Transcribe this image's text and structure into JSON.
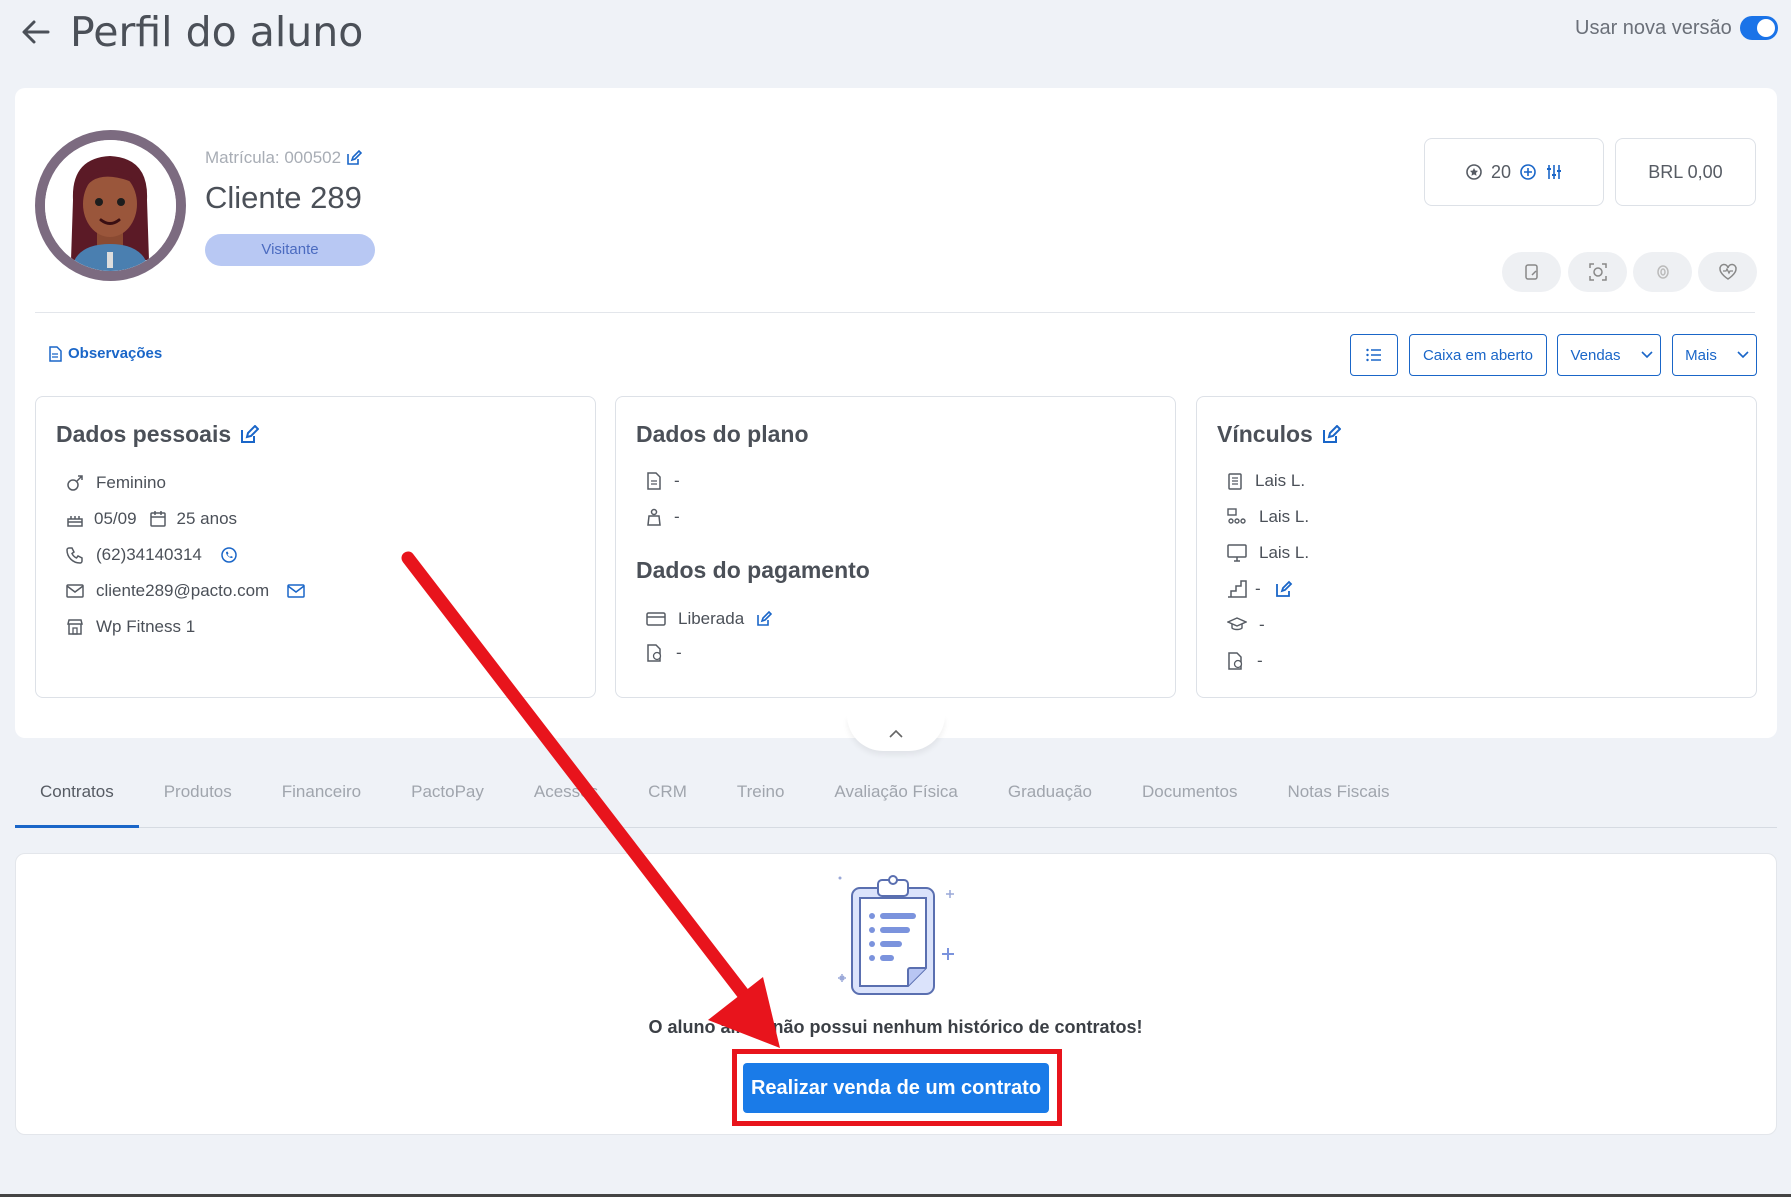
{
  "header": {
    "title": "Perfil do aluno",
    "toggle_label": "Usar nova versão"
  },
  "profile": {
    "matricula": "Matrícula: 000502",
    "name": "Cliente 289",
    "badge": "Visitante",
    "points": "20",
    "balance": "BRL 0,00"
  },
  "toolbar": {
    "observations": "Observações",
    "caixa": "Caixa em aberto",
    "vendas": "Vendas",
    "mais": "Mais"
  },
  "personal": {
    "title": "Dados pessoais",
    "gender": "Feminino",
    "birthday": "05/09",
    "age": "25 anos",
    "phone": "(62)34140314",
    "email": "cliente289@pacto.com",
    "unit": "Wp Fitness 1"
  },
  "plan": {
    "title": "Dados do plano",
    "plan_value": "-",
    "plan_extra": "-",
    "payment_title": "Dados do pagamento",
    "payment_status": "Liberada",
    "payment_extra": "-"
  },
  "vinculos": {
    "title": "Vínculos",
    "consultor": "Lais L.",
    "professor": "Lais L.",
    "terminal": "Lais L.",
    "nivel": "-",
    "graduacao": "-",
    "financeiro": "-"
  },
  "tabs": [
    "Contratos",
    "Produtos",
    "Financeiro",
    "PactoPay",
    "Acessos",
    "CRM",
    "Treino",
    "Avaliação Física",
    "Graduação",
    "Documentos",
    "Notas Fiscais"
  ],
  "contracts": {
    "empty_message": "O aluno ainda não possui nenhum histórico de contratos!",
    "sell_button": "Realizar venda de um contrato"
  },
  "colors": {
    "primary": "#1a66c8",
    "button": "#1a7be8",
    "annotation": "#e8141c"
  }
}
